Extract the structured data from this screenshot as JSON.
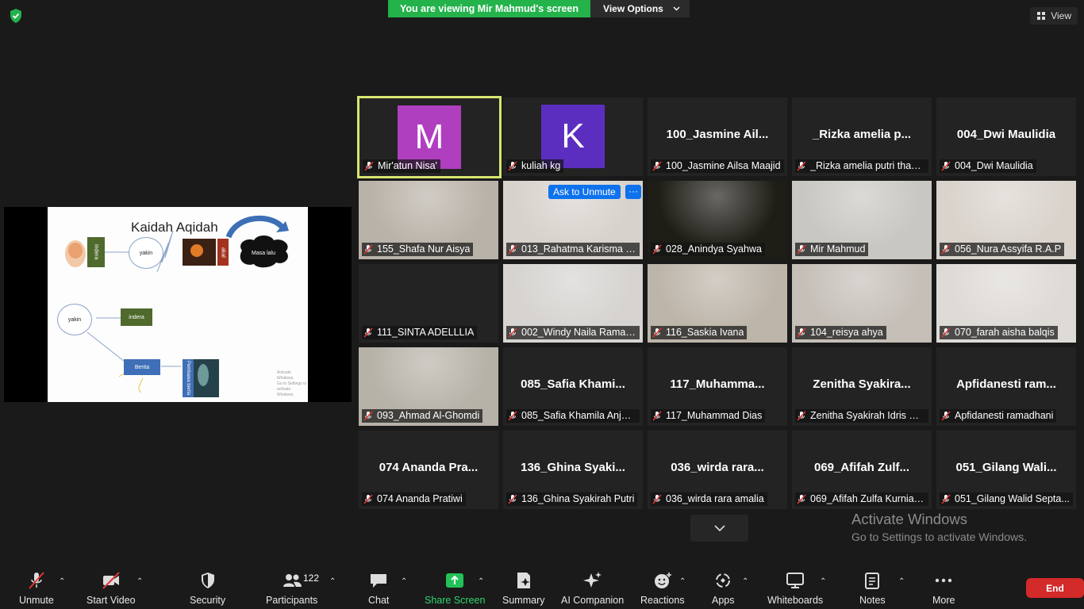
{
  "banner": {
    "viewing_text": "You are viewing Mir Mahmud's screen",
    "view_options_label": "View Options"
  },
  "view_button": {
    "label": "View"
  },
  "slide": {
    "title": "Kaidah Aqidah",
    "labels": {
      "indera_vertical": "indera",
      "yakin_top": "yakin",
      "akal": "akal",
      "masa_lalu": "Masa lalu",
      "yakin_bottom": "yakin",
      "indera_box": "indera",
      "berita": "Berita",
      "pembawa_berita": "Pembawa berita"
    },
    "watermark_line1": "Activate Windows",
    "watermark_line2": "Go to Settings to activate Windows."
  },
  "participants": [
    {
      "name": "Mir'atun Nisa'",
      "avatar": "M",
      "avatar_color": "#b03fc0",
      "active": true
    },
    {
      "name": "kuliah kg",
      "avatar": "K",
      "avatar_color": "#5c2ec0"
    },
    {
      "name": "100_Jasmine Ailsa Maajid",
      "big": "100_Jasmine Ail..."
    },
    {
      "name": "_Rizka amelia putri tham...",
      "big": "_Rizka amelia p..."
    },
    {
      "name": "004_Dwi Maulidia",
      "big": "004_Dwi Maulidia"
    },
    {
      "name": "155_Shafa Nur Aisya",
      "video": "#b9b2a8"
    },
    {
      "name": "013_Rahatma Karisma D...",
      "video": "#d8d2cc",
      "ask_unmute": "Ask to Unmute"
    },
    {
      "name": "028_Anindya Syahwa",
      "video": "#1e1d16"
    },
    {
      "name": "Mir Mahmud",
      "video": "#c9c7c1"
    },
    {
      "name": "056_Nura Assyifa R.A.P",
      "video": "#d9d3cc"
    },
    {
      "name": "111_SINTA ADELLLIA",
      "big": ""
    },
    {
      "name": "002_Windy Naila Ramad...",
      "video": "#d6d3d0"
    },
    {
      "name": "116_Saskia Ivana",
      "video": "#bdb5a9"
    },
    {
      "name": "104_reisya ahya",
      "video": "#c5bfb8"
    },
    {
      "name": "070_farah aisha balqis",
      "video": "#dedad6"
    },
    {
      "name": "093_Ahmad Al-Ghomdi",
      "video": "#b7b2a8"
    },
    {
      "name": "085_Safia Khamila Anjas...",
      "big": "085_Safia Khami..."
    },
    {
      "name": "117_Muhammad Dias",
      "big": "117_Muhamma..."
    },
    {
      "name": "Zenitha Syakirah Idris Pu...",
      "big": "Zenitha Syakira..."
    },
    {
      "name": "Apfidanesti ramadhani",
      "big": "Apfidanesti ram..."
    },
    {
      "name": "074 Ananda Pratiwi",
      "big": "074 Ananda Pra..."
    },
    {
      "name": "136_Ghina Syakirah Putri",
      "big": "136_Ghina Syaki..."
    },
    {
      "name": "036_wirda rara amalia",
      "big": "036_wirda rara..."
    },
    {
      "name": "069_Afifah Zulfa Kurnias...",
      "big": "069_Afifah Zulf..."
    },
    {
      "name": "051_Gilang Walid Septa...",
      "big": "051_Gilang Wali..."
    }
  ],
  "tile_dots": "···",
  "activate": {
    "line1": "Activate Windows",
    "line2": "Go to Settings to activate Windows."
  },
  "toolbar": {
    "unmute": "Unmute",
    "start_video": "Start Video",
    "security": "Security",
    "participants": "Participants",
    "participants_count": "122",
    "chat": "Chat",
    "share_screen": "Share Screen",
    "summary": "Summary",
    "ai_companion": "AI Companion",
    "reactions": "Reactions",
    "apps": "Apps",
    "whiteboards": "Whiteboards",
    "notes": "Notes",
    "more": "More",
    "end": "End"
  },
  "colors": {
    "banner_green": "#24b24b",
    "active_border": "#d7e570",
    "end_red": "#d32a2a",
    "share_green": "#2fd66b",
    "ask_blue": "#0e72ed"
  }
}
